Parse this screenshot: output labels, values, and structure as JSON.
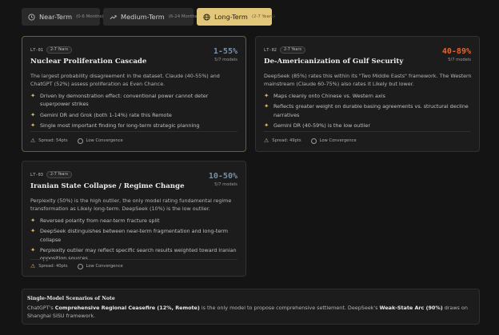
{
  "tabs": [
    {
      "label": "Near-Term",
      "sub": "(0-6 Months)",
      "icon": "clock-icon",
      "active": false
    },
    {
      "label": "Medium-Term",
      "sub": "(6-24 Months)",
      "icon": "trend-icon",
      "active": false
    },
    {
      "label": "Long-Term",
      "sub": "(2-7 Years)",
      "icon": "globe-icon",
      "active": true
    }
  ],
  "colors": {
    "accent": "#e2c77a",
    "hot": "#e8642c",
    "cool": "#7b8ea3",
    "bullet": "#d9b660"
  },
  "cards": [
    {
      "id": "LT-01",
      "horizon": "2-7 Years",
      "title": "Nuclear Proliferation Cascade",
      "range": "1-55%",
      "models": "5/7 models",
      "desc": "The largest probability disagreement in the dataset. Claude (40-55%) and ChatGPT (52%) assess proliferation as Even Chance.",
      "bullets": [
        "Driven by demonstration effect: conventional power cannot deter superpower strikes",
        "Gemini DR and Grok (both 1-14%) rate this Remote",
        "Single most important finding for long-term strategic planning"
      ],
      "spread": "Spread: 54pts",
      "convergence": "Low Convergence"
    },
    {
      "id": "LT-02",
      "horizon": "2-7 Years",
      "title": "De-Americanization of Gulf Security",
      "range": "40-89%",
      "models": "5/7 models",
      "desc": "DeepSeek (85%) rates this within its \"Two Middle Easts\" framework. The Western mainstream (Claude 60-75%) also rates it Likely but lower.",
      "bullets": [
        "Maps cleanly onto Chinese vs. Western axis",
        "Reflects greater weight on durable basing agreements vs. structural decline narratives",
        "Gemini DR (40-59%) is the low outlier"
      ],
      "spread": "Spread: 49pts",
      "convergence": "Low Convergence"
    },
    {
      "id": "LT-03",
      "horizon": "2-7 Years",
      "title": "Iranian State Collapse / Regime Change",
      "range": "10-50%",
      "models": "5/7 models",
      "desc": "Perplexity (50%) is the high outlier, the only model rating fundamental regime transformation as Likely long-term. DeepSeek (10%) is the low outlier.",
      "bullets": [
        "Reversed polarity from near-term fracture split",
        "DeepSeek distinguishes between near-term fragmentation and long-term collapse",
        "Perplexity outlier may reflect specific search results weighted toward Iranian opposition sources"
      ],
      "spread": "Spread: 40pts",
      "convergence": "Low Convergence"
    }
  ],
  "note": {
    "title": "Single-Model Scenarios of Note",
    "p1": "ChatGPT's ",
    "b1": "Comprehensive Regional Ceasefire (12%, Remote)",
    "p2": " is the only model to propose comprehensive settlement. DeepSeek's ",
    "b2": "Weak-State Arc (90%)",
    "p3": " draws on Shanghai SISU framework."
  }
}
